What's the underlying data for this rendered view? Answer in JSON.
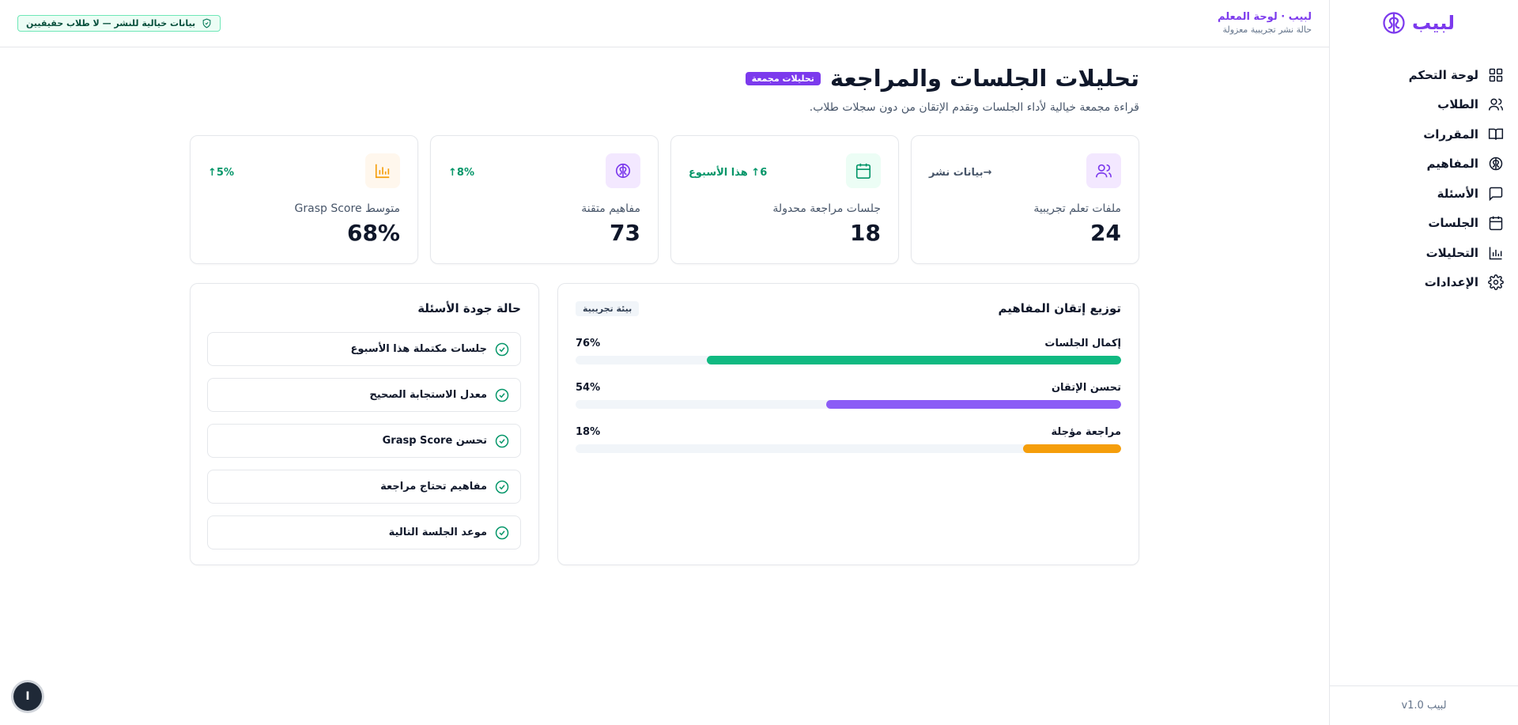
{
  "brand": {
    "name": "لبيب"
  },
  "sidebar": {
    "items": [
      {
        "label": "لوحة التحكم",
        "icon": "grid-icon"
      },
      {
        "label": "الطلاب",
        "icon": "users-icon"
      },
      {
        "label": "المقررات",
        "icon": "book-icon"
      },
      {
        "label": "المفاهيم",
        "icon": "brain-icon"
      },
      {
        "label": "الأسئلة",
        "icon": "message-icon"
      },
      {
        "label": "الجلسات",
        "icon": "calendar-icon"
      },
      {
        "label": "التحليلات",
        "icon": "chart-icon"
      },
      {
        "label": "الإعدادات",
        "icon": "gear-icon"
      }
    ],
    "version": "لبيب v1.0"
  },
  "header": {
    "title": "لبيب · لوحة المعلم",
    "subtitle": "حالة نشر تجريبية معزولة",
    "demo_badge": "بيانات خيالية للنشر — لا طلاب حقيقيين"
  },
  "page": {
    "title": "تحليلات الجلسات والمراجعة",
    "tag": "تحليلات مجمعة",
    "description": "قراءة مجمعة خيالية لأداء الجلسات وتقدم الإتقان من دون سجلات طلاب."
  },
  "stats": [
    {
      "label": "ملفات تعلم تجريبية",
      "value": "24",
      "trend": "→بيانات نشر",
      "icon": "users-icon",
      "trend_color": "#475569",
      "icon_bg": "#f3e8ff",
      "icon_color": "#7c3aed"
    },
    {
      "label": "جلسات مراجعة محدولة",
      "value": "18",
      "trend": "6↑ هذا الأسبوع",
      "icon": "calendar-icon",
      "trend_color": "#059669",
      "icon_bg": "#ecfdf5",
      "icon_color": "#059669"
    },
    {
      "label": "مفاهيم متقنة",
      "value": "73",
      "trend": "8%↑",
      "icon": "brain-icon",
      "trend_color": "#059669",
      "icon_bg": "#f3e8ff",
      "icon_color": "#7c3aed"
    },
    {
      "label": "متوسط Grasp Score",
      "value": "68%",
      "trend": "5%↑",
      "icon": "chart-icon",
      "trend_color": "#059669",
      "icon_bg": "#fff7ed",
      "icon_color": "#f59e0b"
    }
  ],
  "distribution": {
    "title": "توزيع إتقان المفاهيم",
    "chip": "بيئة تجريبية",
    "bars": [
      {
        "label": "إكمال الجلسات",
        "value": "76%",
        "pct": 76,
        "color": "#10b981"
      },
      {
        "label": "تحسن الإتقان",
        "value": "54%",
        "pct": 54,
        "color": "#8b5cf6"
      },
      {
        "label": "مراجعة مؤجلة",
        "value": "18%",
        "pct": 18,
        "color": "#f59e0b"
      }
    ]
  },
  "quality": {
    "title": "حالة جودة الأسئلة",
    "items": [
      "جلسات مكتملة هذا الأسبوع",
      "معدل الاستجابة الصحيح",
      "تحسن Grasp Score",
      "مفاهيم تحتاج مراجعة",
      "موعد الجلسة التالية"
    ]
  },
  "help": {
    "label": "I"
  }
}
